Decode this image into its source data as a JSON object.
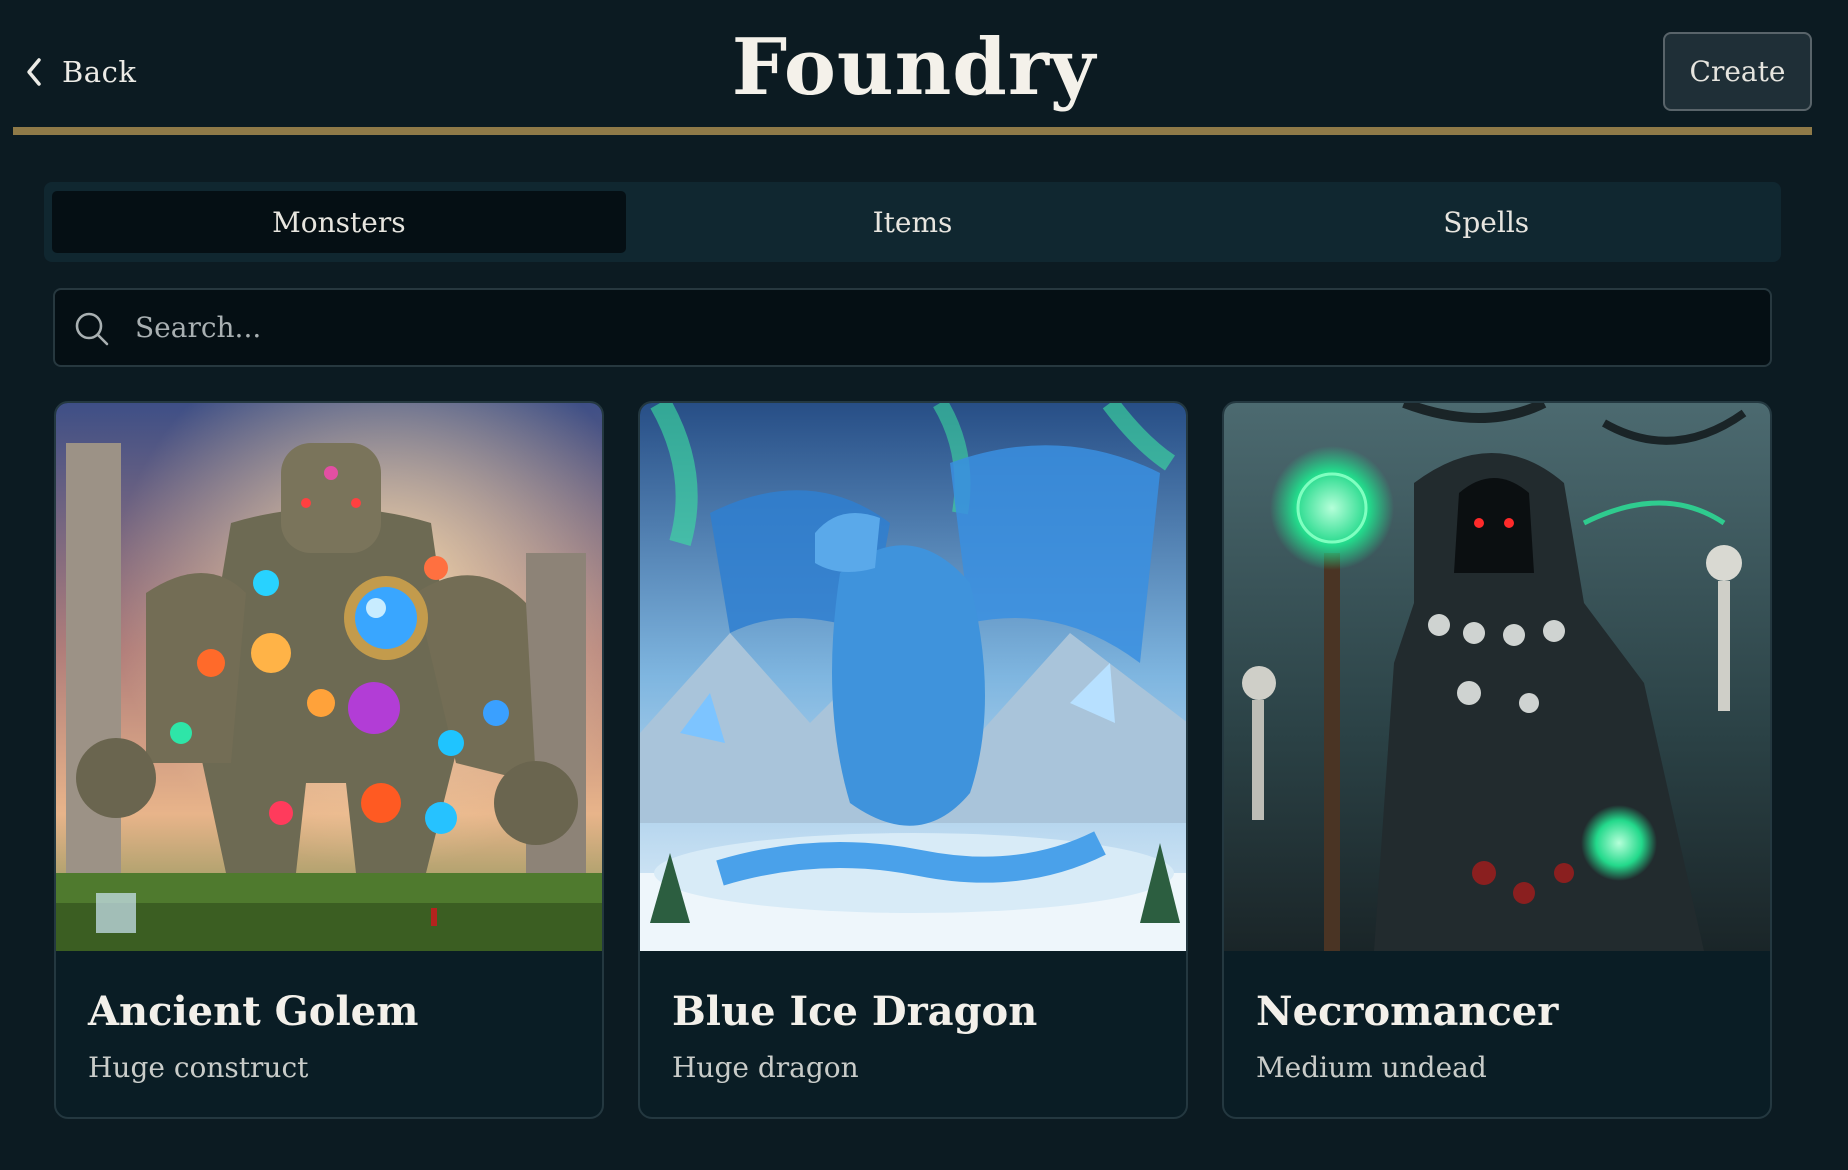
{
  "header": {
    "back_label": "Back",
    "title": "Foundry",
    "create_label": "Create"
  },
  "tabs": [
    {
      "label": "Monsters",
      "active": true
    },
    {
      "label": "Items",
      "active": false
    },
    {
      "label": "Spells",
      "active": false
    }
  ],
  "search": {
    "placeholder": "Search...",
    "value": ""
  },
  "cards": [
    {
      "title": "Ancient Golem",
      "subtitle": "Huge construct",
      "image": "golem-illustration"
    },
    {
      "title": "Blue Ice Dragon",
      "subtitle": "Huge dragon",
      "image": "ice-dragon-illustration"
    },
    {
      "title": "Necromancer",
      "subtitle": "Medium undead",
      "image": "necromancer-illustration"
    }
  ],
  "colors": {
    "background": "#0c1b22",
    "accent_divider": "#8f7a48",
    "tab_active": "#050f14",
    "card_background": "#0a1d25"
  }
}
